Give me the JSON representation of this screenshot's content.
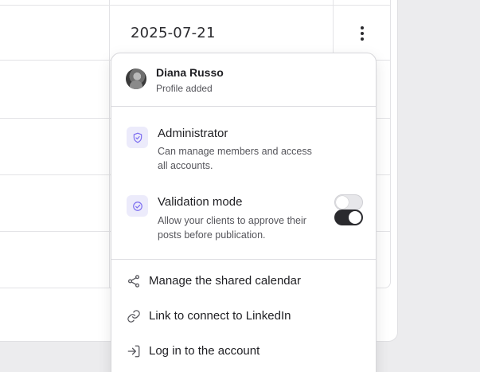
{
  "table": {
    "date_value": "2025-07-21"
  },
  "menu": {
    "user": {
      "name": "Diana Russo",
      "subtitle": "Profile added"
    },
    "options": [
      {
        "title": "Administrator",
        "description": "Can manage members and access all accounts.",
        "enabled": false,
        "icon": "shield-check-icon"
      },
      {
        "title": "Validation mode",
        "description": "Allow your clients to approve their posts before publication.",
        "enabled": true,
        "icon": "circle-check-icon"
      }
    ],
    "actions": [
      {
        "label": "Manage the shared calendar",
        "icon": "share-icon"
      },
      {
        "label": "Link to connect to LinkedIn",
        "icon": "link-icon"
      },
      {
        "label": "Log in to the account",
        "icon": "login-icon"
      }
    ]
  },
  "colors": {
    "accent": "#7b6cf0",
    "accent_bg": "#ecebfb",
    "toggle_on": "#2a2a2e",
    "border": "#dcdce0"
  }
}
